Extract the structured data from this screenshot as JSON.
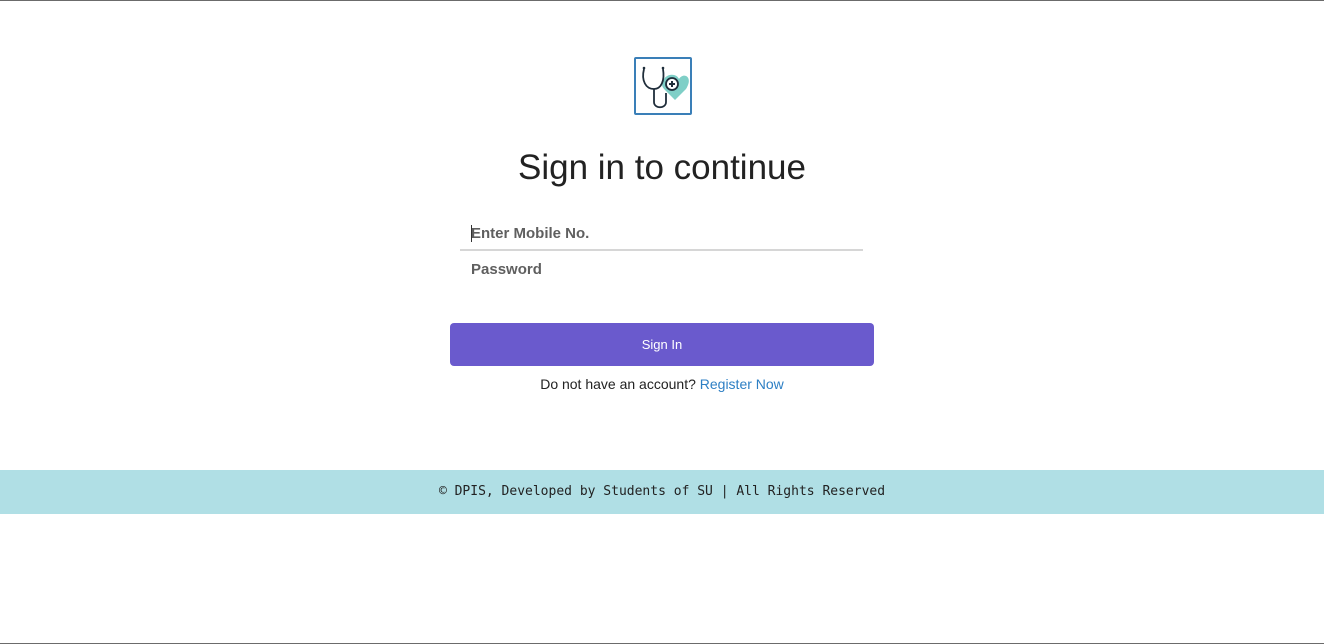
{
  "logo": {
    "icon": "stethoscope-heart-icon",
    "accent": "#7fcfc7",
    "border": "#3a7fb8"
  },
  "heading": "Sign in to continue",
  "form": {
    "mobile_placeholder": "Enter Mobile No.",
    "password_placeholder": "Password",
    "submit_label": "Sign In"
  },
  "register": {
    "prompt": "Do not have an account?",
    "link_label": "Register Now"
  },
  "footer": {
    "text": "© DPIS, Developed by Students of SU | All Rights Reserved"
  },
  "colors": {
    "primary_button": "#6a5acd",
    "link": "#2d7fc4",
    "footer_bg": "#b0dfe5"
  }
}
